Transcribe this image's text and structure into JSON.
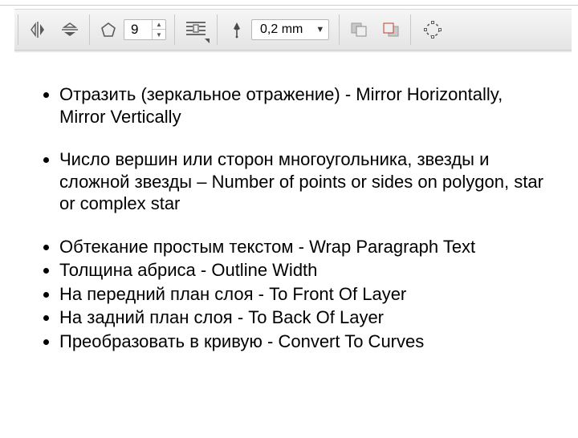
{
  "toolbar": {
    "polygon_sides": "9",
    "outline_width": "0,2 mm",
    "icons": {
      "mirror_h": "mirror-horizontal-icon",
      "mirror_v": "mirror-vertical-icon",
      "polygon": "polygon-icon",
      "wrap": "wrap-text-icon",
      "pen": "outline-pen-icon",
      "to_front": "to-front-of-layer-icon",
      "to_back": "to-back-of-layer-icon",
      "convert": "convert-to-curves-icon"
    }
  },
  "bullets": {
    "b1": "Отразить (зеркальное отражение) - Mirror Horizontally, Mirror Vertically",
    "b2": "Число вершин или сторон многоугольника, звезды и сложной звезды – Number of points or sides on polygon, star or complex star",
    "b3": "Обтекание простым текстом - Wrap Paragraph Text",
    "b4": "Толщина абриса - Outline Width",
    "b5": "На передний план слоя - To Front Of Layer",
    "b6": "На задний план слоя - To Back Of Layer",
    "b7": "Преобразовать в кривую - Convert To Curves"
  }
}
